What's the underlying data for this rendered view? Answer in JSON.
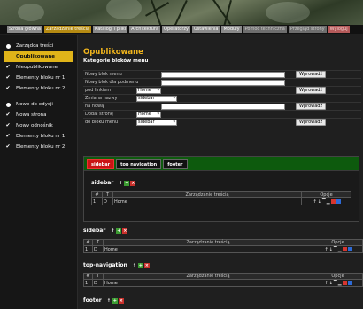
{
  "nav": {
    "tabs": [
      {
        "label": "Strona główna",
        "state": "normal"
      },
      {
        "label": "Zarządzanie treścią",
        "state": "active"
      },
      {
        "label": "Katalogi i pliki",
        "state": "normal"
      },
      {
        "label": "Architektura",
        "state": "normal"
      },
      {
        "label": "Operatorzy",
        "state": "normal"
      },
      {
        "label": "Ustawienia",
        "state": "normal"
      },
      {
        "label": "Moduły",
        "state": "normal"
      },
      {
        "label": "Pomoc techniczna",
        "state": "dim"
      },
      {
        "label": "Przegląd strony",
        "state": "dim"
      },
      {
        "label": "Wyloguj",
        "state": "red"
      }
    ]
  },
  "sidebar": {
    "groups": [
      {
        "title": "Zarządca treści",
        "items": [
          "Opublikowane",
          "Nieopublikowane",
          "Elementy bloku nr 1",
          "Elementy bloku nr 2"
        ],
        "active_index": 0
      },
      {
        "title": "Nowe do edycji",
        "items": [
          "Nowa strona",
          "Nowy odnośnik",
          "Elementy bloku nr 1",
          "Elementy bloku nr 2"
        ]
      }
    ]
  },
  "main": {
    "title": "Opublikowane",
    "form_title": "Kategorie bloków menu",
    "form": {
      "row1_label": "Nowy blok menu",
      "row1_button": "Wprowadź",
      "row2_label": "Nowy blok dla podmenu",
      "row3_label": "pod linkiem",
      "row3_select": "Home",
      "row3_button": "Wprowadź",
      "row4_label": "Zmiana nazwy",
      "row4_select": "sidebar",
      "row5_label": "na nową",
      "row5_button": "Wprowadź",
      "row6_label": "Dodaj stronę",
      "row6_select": "Home",
      "row7_label": "do bloku menu",
      "row7_select": "sidebar",
      "row7_button": "Wprowadź"
    },
    "panel": {
      "tabs": [
        "sidebar",
        "top navigation",
        "footer"
      ],
      "active_tab": 0,
      "section_title": "sidebar",
      "table": {
        "headers": [
          "#",
          "T",
          "Zarządzanie treścią",
          "Opcje"
        ],
        "rows": [
          {
            "num": "1",
            "type": "D",
            "name": "Home"
          }
        ]
      }
    },
    "blocks": [
      {
        "title": "sidebar",
        "headers": [
          "#",
          "T",
          "Zarządzanie treścią",
          "Opcje"
        ],
        "rows": [
          {
            "num": "1",
            "type": "D",
            "name": "Home"
          }
        ]
      },
      {
        "title": "top-navigation",
        "headers": [
          "#",
          "T",
          "Zarządzanie treścią",
          "Opcje"
        ],
        "rows": [
          {
            "num": "1",
            "type": "D",
            "name": "Home"
          }
        ]
      },
      {
        "title": "footer",
        "headers": [],
        "rows": []
      }
    ]
  },
  "icons": {
    "up": "arrow-up-icon",
    "add": "add-icon",
    "delete": "delete-icon",
    "colors": {
      "add": "#3c9c32",
      "delete": "#c8302b",
      "accent": "#e0b419",
      "active_tab": "#c91414",
      "tabbar": "#0d5a0d"
    }
  }
}
